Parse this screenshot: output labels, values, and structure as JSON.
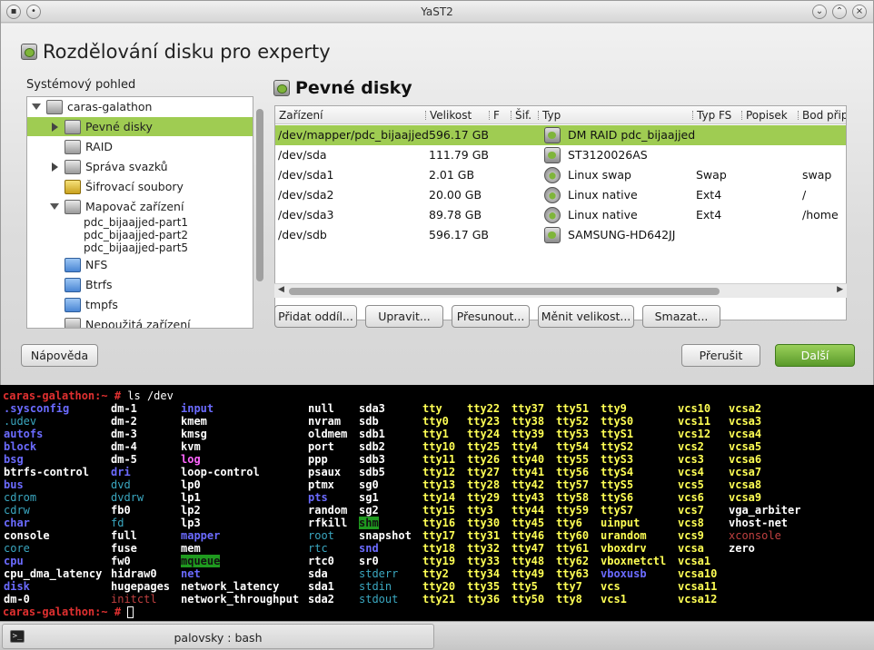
{
  "window": {
    "title": "YaST2"
  },
  "main_title": "Rozdělování disku pro experty",
  "tree": {
    "label": "Systémový pohled",
    "items": [
      {
        "label": "caras-galathon",
        "level": 0,
        "expanded": true
      },
      {
        "label": "Pevné disky",
        "level": 1,
        "collapsed": true,
        "selected": true
      },
      {
        "label": "RAID",
        "level": 1
      },
      {
        "label": "Správa svazků",
        "level": 1,
        "collapsed": true
      },
      {
        "label": "Šifrovací soubory",
        "level": 1
      },
      {
        "label": "Mapovač zařízení",
        "level": 1,
        "expanded": true
      },
      {
        "label": "pdc_bijaajjed-part1",
        "level": 2
      },
      {
        "label": "pdc_bijaajjed-part2",
        "level": 2
      },
      {
        "label": "pdc_bijaajjed-part5",
        "level": 2
      },
      {
        "label": "NFS",
        "level": 1
      },
      {
        "label": "Btrfs",
        "level": 1
      },
      {
        "label": "tmpfs",
        "level": 1
      },
      {
        "label": "Nepoužitá zařízení",
        "level": 1
      }
    ]
  },
  "right_title": "Pevné disky",
  "table": {
    "headers": [
      "Zařízení",
      "Velikost",
      "F",
      "Šif.",
      "Typ",
      "Typ FS",
      "Popisek",
      "Bod připojení"
    ],
    "rows": [
      {
        "device": "/dev/mapper/pdc_bijaajjed",
        "size": "596.17 GB",
        "type": "DM RAID pdc_bijaajjed",
        "fstype": "",
        "mount": "",
        "icon": "disk-icon",
        "selected": true
      },
      {
        "device": "/dev/sda",
        "size": "111.79 GB",
        "type": "ST3120026AS",
        "fstype": "",
        "mount": "",
        "icon": "disk-icon"
      },
      {
        "device": "/dev/sda1",
        "size": "2.01 GB",
        "type": "Linux swap",
        "fstype": "Swap",
        "mount": "swap",
        "icon": "partition-icon"
      },
      {
        "device": "/dev/sda2",
        "size": "20.00 GB",
        "type": "Linux native",
        "fstype": "Ext4",
        "mount": "/",
        "icon": "partition-icon"
      },
      {
        "device": "/dev/sda3",
        "size": "89.78 GB",
        "type": "Linux native",
        "fstype": "Ext4",
        "mount": "/home",
        "icon": "partition-icon"
      },
      {
        "device": "/dev/sdb",
        "size": "596.17 GB",
        "type": "SAMSUNG-HD642JJ",
        "fstype": "",
        "mount": "",
        "icon": "disk-icon"
      }
    ]
  },
  "buttons": {
    "add": "Přidat oddíl...",
    "edit": "Upravit...",
    "move": "Přesunout...",
    "resize": "Měnit velikost...",
    "delete": "Smazat...",
    "help": "Nápověda",
    "abort": "Přerušit",
    "next": "Další"
  },
  "terminal": {
    "prompt": "caras-galathon:~ #",
    "command": " ls /dev",
    "columns": [
      [
        ".sysconfig",
        ".udev",
        "autofs",
        "block",
        "bsg",
        "btrfs-control",
        "bus",
        "cdrom",
        "cdrw",
        "char",
        "console",
        "core",
        "cpu",
        "cpu_dma_latency",
        "disk",
        "dm-0"
      ],
      [
        "dm-1",
        "dm-2",
        "dm-3",
        "dm-4",
        "dm-5",
        "dri",
        "dvd",
        "dvdrw",
        "fb0",
        "fd",
        "full",
        "fuse",
        "fw0",
        "hidraw0",
        "hugepages",
        "initctl"
      ],
      [
        "input",
        "kmem",
        "kmsg",
        "kvm",
        "log",
        "loop-control",
        "lp0",
        "lp1",
        "lp2",
        "lp3",
        "mapper",
        "mem",
        "mqueue",
        "net",
        "network_latency",
        "network_throughput"
      ],
      [
        "null",
        "nvram",
        "oldmem",
        "port",
        "ppp",
        "psaux",
        "ptmx",
        "pts",
        "random",
        "rfkill",
        "root",
        "rtc",
        "rtc0",
        "sda",
        "sda1",
        "sda2"
      ],
      [
        "sda3",
        "sdb",
        "sdb1",
        "sdb2",
        "sdb3",
        "sdb5",
        "sg0",
        "sg1",
        "sg2",
        "shm",
        "snapshot",
        "snd",
        "sr0",
        "stderr",
        "stdin",
        "stdout"
      ],
      [
        "tty",
        "tty0",
        "tty1",
        "tty10",
        "tty11",
        "tty12",
        "tty13",
        "tty14",
        "tty15",
        "tty16",
        "tty17",
        "tty18",
        "tty19",
        "tty2",
        "tty20",
        "tty21"
      ],
      [
        "tty22",
        "tty23",
        "tty24",
        "tty25",
        "tty26",
        "tty27",
        "tty28",
        "tty29",
        "tty3",
        "tty30",
        "tty31",
        "tty32",
        "tty33",
        "tty34",
        "tty35",
        "tty36"
      ],
      [
        "tty37",
        "tty38",
        "tty39",
        "tty4",
        "tty40",
        "tty41",
        "tty42",
        "tty43",
        "tty44",
        "tty45",
        "tty46",
        "tty47",
        "tty48",
        "tty49",
        "tty5",
        "tty50"
      ],
      [
        "tty51",
        "tty52",
        "tty53",
        "tty54",
        "tty55",
        "tty56",
        "tty57",
        "tty58",
        "tty59",
        "tty6",
        "tty60",
        "tty61",
        "tty62",
        "tty63",
        "tty7",
        "tty8"
      ],
      [
        "tty9",
        "ttyS0",
        "ttyS1",
        "ttyS2",
        "ttyS3",
        "ttyS4",
        "ttyS5",
        "ttyS6",
        "ttyS7",
        "uinput",
        "urandom",
        "vboxdrv",
        "vboxnetctl",
        "vboxusb",
        "vcs",
        "vcs1"
      ],
      [
        "vcs10",
        "vcs11",
        "vcs12",
        "vcs2",
        "vcs3",
        "vcs4",
        "vcs5",
        "vcs6",
        "vcs7",
        "vcs8",
        "vcs9",
        "vcsa",
        "vcsa1",
        "vcsa10",
        "vcsa11",
        "vcsa12"
      ],
      [
        "vcsa2",
        "vcsa3",
        "vcsa4",
        "vcsa5",
        "vcsa6",
        "vcsa7",
        "vcsa8",
        "vcsa9",
        "vga_arbiter",
        "vhost-net",
        "xconsole",
        "zero"
      ]
    ],
    "colors": {
      "dir": "#6b6bff",
      "device": "#ffff54",
      "link": "#3aa7c0",
      "prompt": "#e03030"
    },
    "end_prompt": "caras-galathon:~ #"
  },
  "taskbar": {
    "label": "palovsky : bash"
  }
}
